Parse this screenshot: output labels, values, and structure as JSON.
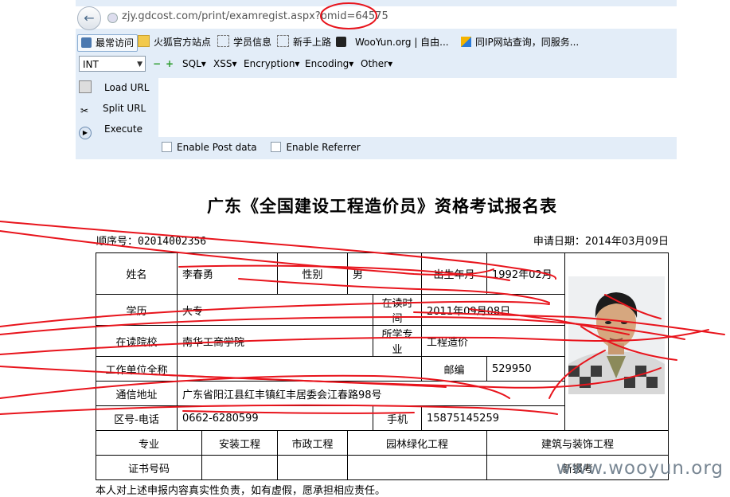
{
  "browser": {
    "url": "zjy.gdcost.com/print/examregist.aspx?bmid=64575",
    "bookmarks": [
      "最常访问",
      "火狐官方站点",
      "学员信息",
      "新手上路",
      "WooYun.org | 自由...",
      "同IP网站查询，同服务..."
    ]
  },
  "hackbar": {
    "select_value": "INT",
    "menus": [
      "SQL▾",
      "XSS▾",
      "Encryption▾",
      "Encoding▾",
      "Other▾"
    ],
    "actions": [
      "Load URL",
      "Split URL",
      "Execute"
    ],
    "checkbox_post": "Enable Post data",
    "checkbox_referrer": "Enable Referrer"
  },
  "form": {
    "title": "广东《全国建设工程造价员》资格考试报名表",
    "serial": "顺序号：02014002356",
    "date": "申请日期：2014年03月09日",
    "labels": {
      "name": "姓名",
      "gender": "性别",
      "birth": "出生年月",
      "edu": "学历",
      "study_time": "在读时间",
      "school": "在读院校",
      "major": "所学专业",
      "employer": "工作单位全称",
      "zip": "邮编",
      "address": "通信地址",
      "phone": "区号-电话",
      "mobile": "手机",
      "specialty": "专业",
      "cert": "证书号码"
    },
    "values": {
      "name": "李春勇",
      "gender": "男",
      "birth": "1992年02月",
      "edu": "大专",
      "study_time": "2011年09月08日",
      "school": "南华工商学院",
      "major": "工程造价",
      "employer": "",
      "zip": "529950",
      "address": "广东省阳江县红丰镇红丰居委会江春路98号",
      "phone": "0662-6280599",
      "mobile": "15875145259"
    },
    "specialties": [
      "安装工程",
      "市政工程",
      "园林绿化工程",
      "建筑与装饰工程"
    ],
    "cert_status": "新报考",
    "declaration": "本人对上述申报内容真实性负责，如有虚假，愿承担相应责任。"
  },
  "watermark": "www.wooyun.org",
  "colors": {
    "scribble": "#e8141c",
    "toolbar": "#e3edf8"
  }
}
